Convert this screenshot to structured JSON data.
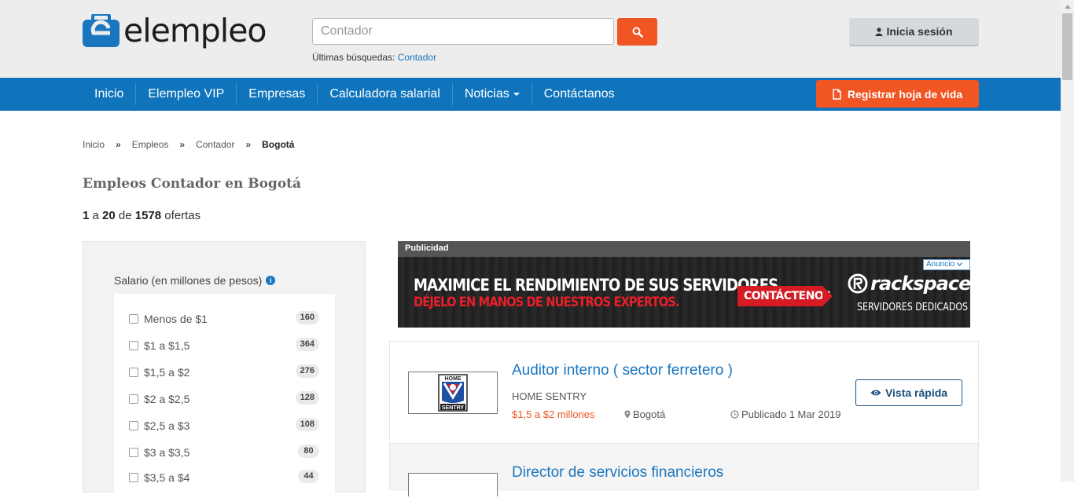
{
  "brand": {
    "name": "elempleo",
    "accent": "#f05523",
    "nav_color": "#0f74bc",
    "link_color": "#1a76bf"
  },
  "search": {
    "placeholder": "Contador",
    "recent_label": "Últimas búsquedas:",
    "recent_item": "Contador",
    "search_icon": "search-icon"
  },
  "login": {
    "label": "Inicia sesión",
    "icon": "user-icon"
  },
  "nav": {
    "items": [
      {
        "label": "Inicio"
      },
      {
        "label": "Elempleo VIP"
      },
      {
        "label": "Empresas"
      },
      {
        "label": "Calculadora salarial"
      },
      {
        "label": "Noticias"
      },
      {
        "label": "Contáctanos"
      }
    ],
    "register_label": "Registrar hoja de vida"
  },
  "breadcrumb": {
    "items": [
      "Inicio",
      "Empleos",
      "Contador"
    ],
    "separator": "»",
    "current": "Bogotá"
  },
  "page": {
    "title": "Empleos Contador en Bogotá",
    "range_start": "1",
    "range_connector": "a",
    "range_end": "20",
    "of": "de",
    "total": "1578",
    "unit": "ofertas"
  },
  "filters": {
    "title": "Salario (en millones de pesos)",
    "info_icon": "i",
    "options": [
      {
        "label": "Menos de $1",
        "count": "160"
      },
      {
        "label": "$1 a $1,5",
        "count": "364"
      },
      {
        "label": "$1,5 a $2",
        "count": "276"
      },
      {
        "label": "$2 a $2,5",
        "count": "128"
      },
      {
        "label": "$2,5 a $3",
        "count": "108"
      },
      {
        "label": "$3 a $3,5",
        "count": "80"
      },
      {
        "label": "$3,5 a $4",
        "count": "44"
      }
    ]
  },
  "ad": {
    "label": "Publicidad",
    "choices": "Anuncio",
    "headline": "MAXIMICE EL RENDIMIENTO DE SUS SERVIDORES.",
    "subline": "DÉJELO EN MANOS DE NUESTROS EXPERTOS.",
    "cta": "CONTÁCTENOS",
    "brand": "rackspace",
    "brand_sub": "SERVIDORES DEDICADOS"
  },
  "jobs": [
    {
      "title": "Auditor interno ( sector ferretero )",
      "company": "HOME SENTRY",
      "logo_text_top": "HOME",
      "logo_text_bottom": "SENTRY",
      "salary": "$1,5 a $2 millones",
      "location": "Bogotá",
      "published": "Publicado 1 Mar 2019",
      "action": "Vista rápida"
    },
    {
      "title": "Director de servicios financieros"
    }
  ]
}
